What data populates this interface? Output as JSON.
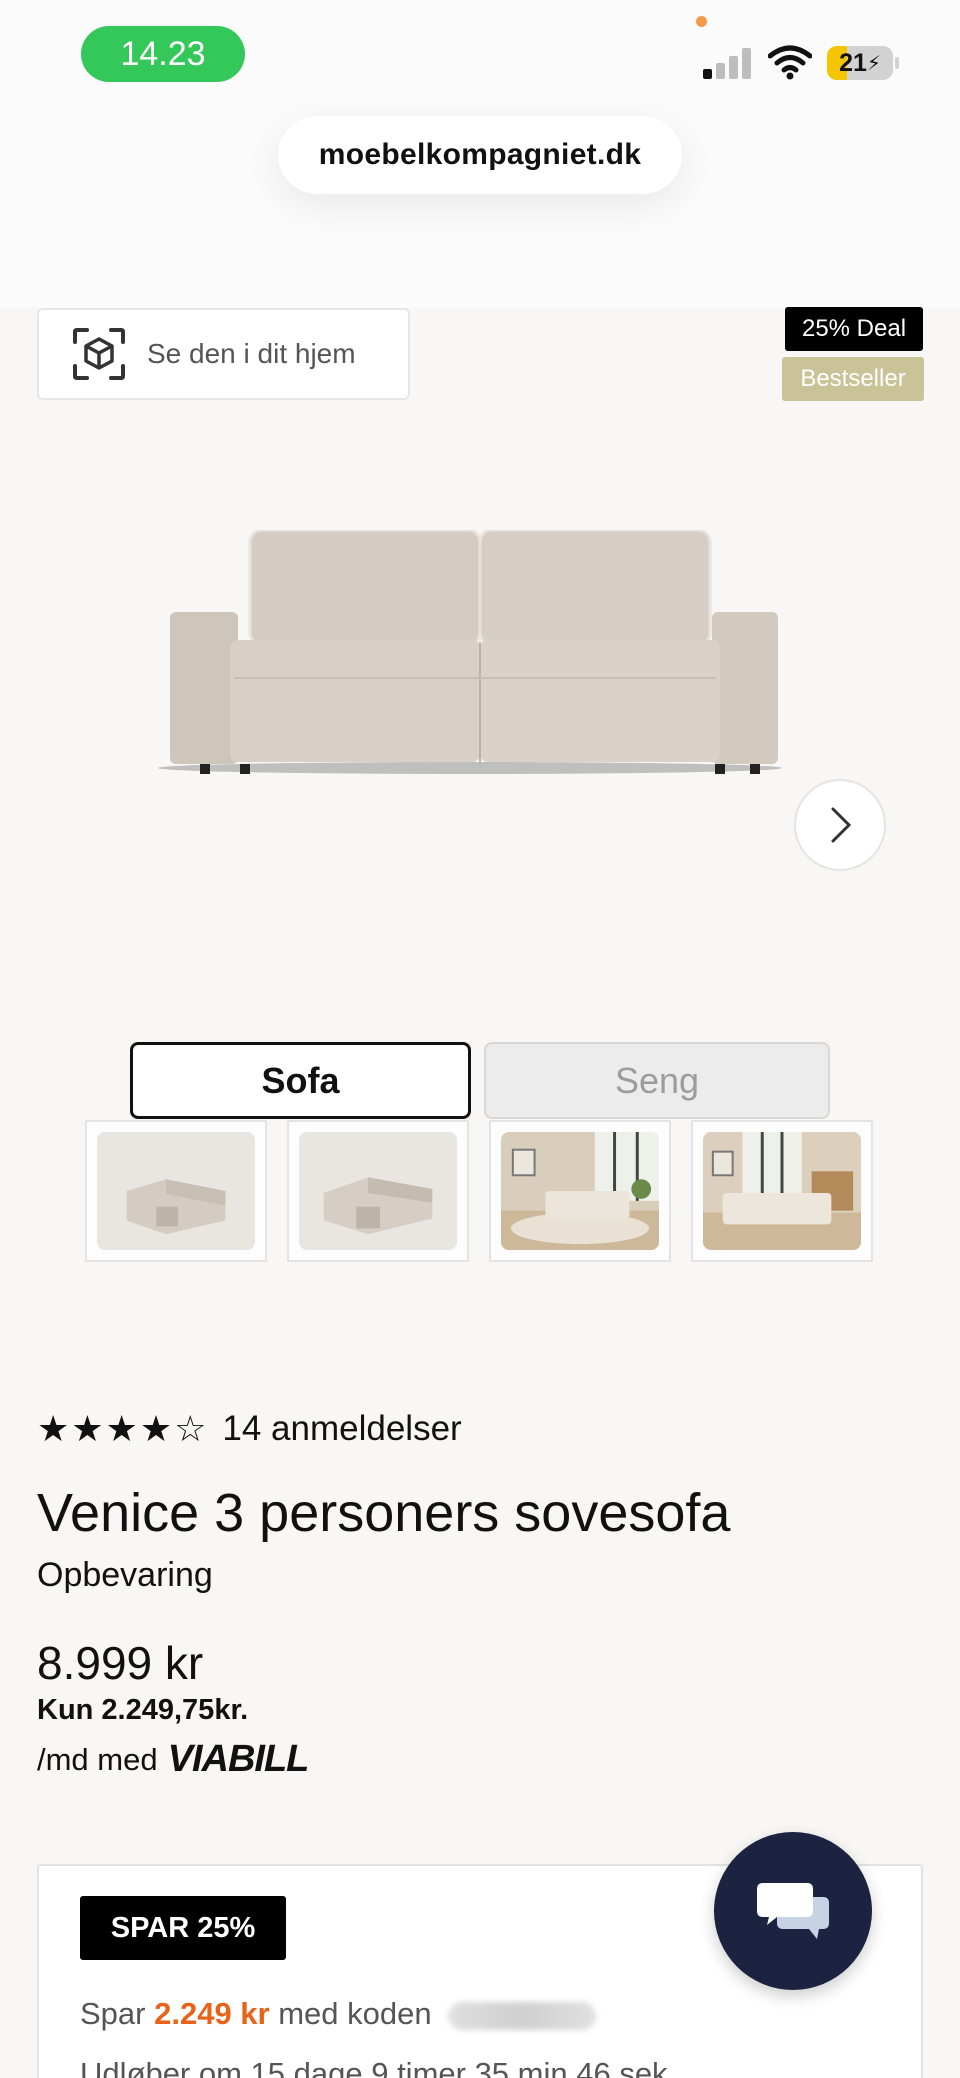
{
  "status_bar": {
    "time": "14.23",
    "battery": "21",
    "battery_icon": "battery-charging-icon",
    "signal_icon": "cellular-signal-icon",
    "wifi_icon": "wifi-icon"
  },
  "browser": {
    "url": "moebelkompagniet.dk"
  },
  "product_media": {
    "ar_button_label": "Se den i dit hjem",
    "ar_icon": "ar-cube-icon",
    "badges": [
      "25% Deal",
      "Bestseller"
    ],
    "next_icon": "chevron-right-icon",
    "view_toggle": {
      "active": "Sofa",
      "inactive": "Seng"
    },
    "thumbnails": [
      "sofa-bed-open-studio",
      "sofa-bed-open-studio-2",
      "sofa-bed-room-scene",
      "sofa-bed-room-scene-2"
    ]
  },
  "product": {
    "rating_value": 4.5,
    "rating_max": 5,
    "stars_text": "★★★★☆",
    "reviews": "14 anmeldelser",
    "title": "Venice 3 personers sovesofa",
    "subtitle": "Opbevaring",
    "price": "8.999 kr",
    "installment": "Kun 2.249,75kr.",
    "per_month": "/md med",
    "financing_brand": "VIABILL"
  },
  "promo": {
    "badge": "SPAR 25%",
    "save_prefix": "Spar",
    "save_amount": "2.249 kr",
    "save_suffix": "med koden",
    "expires": "Udløber om 15 dage 9 timer 35 min 46 sek"
  },
  "chat": {
    "icon": "chat-bubbles-icon"
  },
  "colors": {
    "accent_green": "#34c759",
    "promo_orange": "#e8631a",
    "badge_gold": "#c9c397",
    "chat_navy": "#1c2340"
  }
}
